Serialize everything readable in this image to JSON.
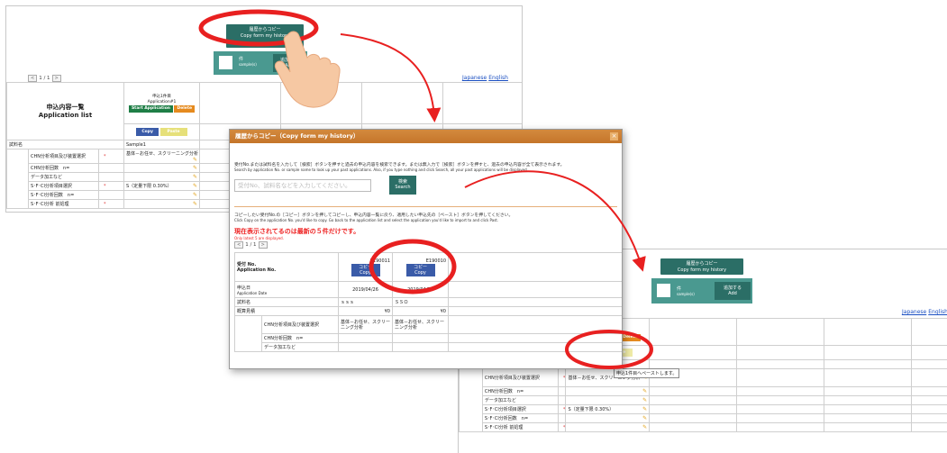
{
  "history_button": {
    "label_ja": "履歴からコピー",
    "label_en": "Copy form my history"
  },
  "sample_box": {
    "count": "件",
    "unit": "sample(s)",
    "add_ja": "追加する",
    "add_en": "Add"
  },
  "pager": {
    "prev": "<",
    "page": "1 / 1",
    "next": ">"
  },
  "lang": {
    "ja": "Japanese",
    "en": "English"
  },
  "app_list": {
    "title_ja": "申込内容一覧",
    "title_en": "Application list",
    "app_head_ja": "申込1件目",
    "app_head_en": "Application#1",
    "start": "Start Application",
    "delete": "Delete",
    "copy": "Copy",
    "paste": "Paste",
    "sample_label": "試料名",
    "sample_value": "Sample1",
    "rows": [
      {
        "label": "CHN分析項目及び装置選択",
        "required": "*",
        "value": "基体－お任せ、スクリーニング分析"
      },
      {
        "label": "CHN分析回数　n=",
        "required": "",
        "value": ""
      },
      {
        "label": "データ加工など",
        "required": "",
        "value": ""
      },
      {
        "label": "S･F･Cl分析項目選択",
        "required": "*",
        "value": "S（定量下限 0.30%）"
      },
      {
        "label": "S･F･Cl分析回数　n=",
        "required": "",
        "value": ""
      },
      {
        "label": "S･F･Cl分析 前処理",
        "required": "*",
        "value": ""
      }
    ],
    "group_label": "分析項目"
  },
  "dialog": {
    "title": "履歴からコピー（Copy form my history）",
    "close": "×",
    "desc_ja": "受付No.または試料名を入力して［検索］ボタンを押すと過去の申込内容を検索できます。または無入力で［検索］ボタンを押すと、過去の申込内容が全て表示されます。",
    "desc_en": "Search by application No. or sample name to look up your past applications. Also, if you type nothing and click Search, all your past applications will be displayed.",
    "search_placeholder": "受付No、試料名などを入力してください。",
    "search_ja": "検索",
    "search_en": "Search",
    "copy_desc_ja": "コピーしたい受付No.の［コピー］ボタンを押してコピーし、申込内容一覧に戻り、適用したい申込先の［ペースト］ボタンを押してください。",
    "copy_desc_en": "Click Copy on the application No. you'd like to copy. Go back to the application list and select the application you'd like to import to and click Past.",
    "warn": "現在表示されてるのは最新の５件だけです。",
    "warn_sub": "Only latest 5 are displayed.",
    "table": {
      "recv_label_ja": "受付 No.",
      "recv_label_en": "Application No.",
      "col1_no": "E190011",
      "col2_no": "E190010",
      "copy_ja": "コピー",
      "copy_en": "Copy",
      "date_label_ja": "申込日",
      "date_label_en": "Application Date",
      "col1_date": "2019/04/26",
      "col2_date": "2019/04/26",
      "sample_label": "試料名",
      "col1_sample": "ｓｓｓ",
      "col2_sample": "ＳＳＯ",
      "estimate_label": "概算見積",
      "col1_est": "¥0",
      "col2_est": "¥0",
      "chn_label": "CHN分析項目及び装置選択",
      "col1_chn": "基体－お任せ、スクリーニング分析",
      "col2_chn": "基体－お任せ、スクリーニング分析",
      "chn_count": "CHN分析回数　n=",
      "data_proc": "データ加工など"
    }
  },
  "tooltip": "申込1件目へペーストします。"
}
